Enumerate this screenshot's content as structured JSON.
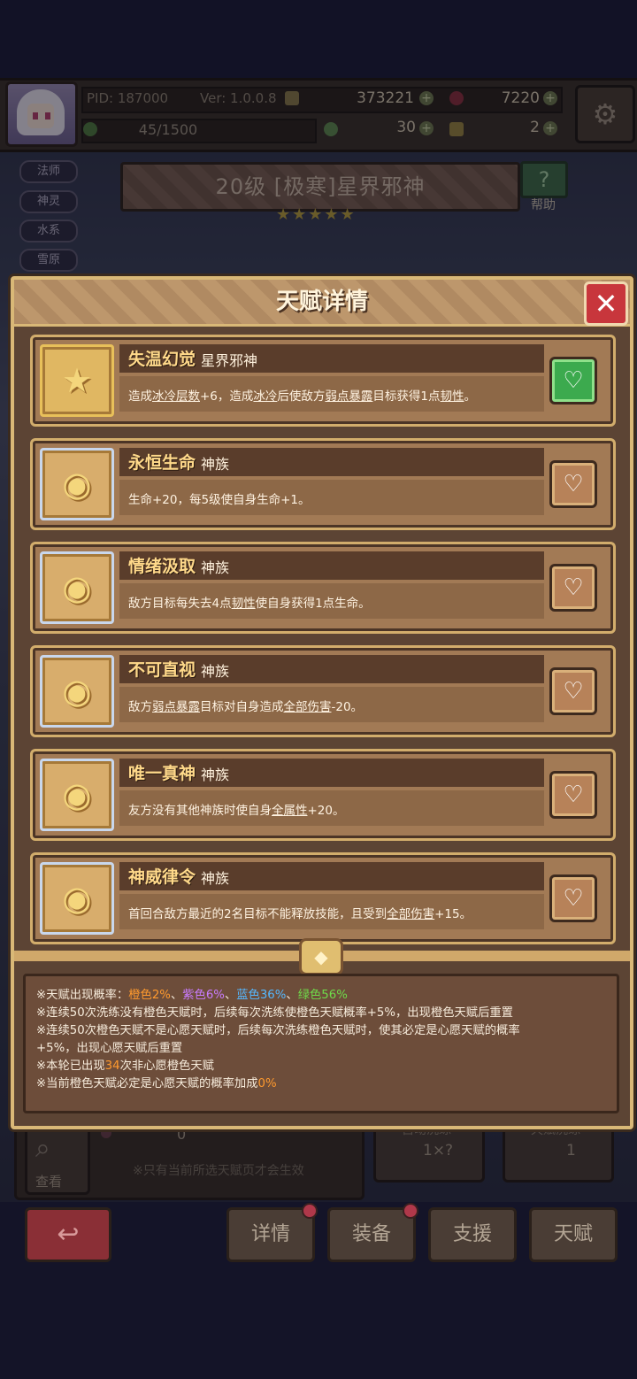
{
  "status_bar": {
    "pid": "PID: 187000",
    "version": "Ver: 1.0.0.8",
    "coins": "373221",
    "gems": "7220",
    "exp": "45/1500",
    "clover": "30",
    "keys": "2"
  },
  "side_tags": [
    "法师",
    "神灵",
    "水系",
    "雪原"
  ],
  "hero": {
    "title": "20级  [极寒]星界邪神",
    "stars": "★★★★★",
    "help_label": "帮助"
  },
  "background": {
    "count_value": "0",
    "note": "※只有当前所选天赋页才会生效",
    "view_label": "查看",
    "auto_wash_label": "自动洗练",
    "auto_wash_value": "1×?",
    "wash_label": "天赋洗练",
    "wash_value": "1",
    "nav": [
      "详情",
      "装备",
      "支援",
      "天赋"
    ]
  },
  "modal": {
    "title": "天赋详情",
    "close": "✕",
    "talents": [
      {
        "name": "失温幻觉",
        "tribe": "星界邪神",
        "desc_parts": [
          "造成",
          "冰冷层数",
          "+6，造成",
          "冰冷",
          "后使敌方",
          "弱点暴露",
          "目标获得1点",
          "韧性",
          "。"
        ],
        "favorited": true
      },
      {
        "name": "永恒生命",
        "tribe": "神族",
        "desc_parts": [
          "生命+20，每5级使自身生命+1。"
        ],
        "favorited": false
      },
      {
        "name": "情绪汲取",
        "tribe": "神族",
        "desc_parts": [
          "敌方目标每失去4点",
          "韧性",
          "使自身获得1点生命。"
        ],
        "favorited": false
      },
      {
        "name": "不可直视",
        "tribe": "神族",
        "desc_parts": [
          "敌方",
          "弱点暴露",
          "目标对自身造成",
          "全部伤害",
          "-20。"
        ],
        "favorited": false
      },
      {
        "name": "唯一真神",
        "tribe": "神族",
        "desc_parts": [
          "友方没有其他神族时使自身",
          "全属性",
          "+20。"
        ],
        "favorited": false
      },
      {
        "name": "神威律令",
        "tribe": "神族",
        "desc_parts": [
          "首回合敌方最近的2名目标不能释放技能，且受到",
          "全部伤害",
          "+15。"
        ],
        "favorited": false
      }
    ],
    "info": {
      "rate_prefix": "※天赋出现概率：",
      "orange": "橙色2%",
      "sep": "、",
      "purple": "紫色6%",
      "blue": "蓝色36%",
      "green": "绿色56%",
      "line2": "※连续50次洗练没有橙色天赋时，后续每次洗练使橙色天赋概率+5%，出现橙色天赋后重置",
      "line3": "※连续50次橙色天赋不是心愿天赋时，后续每次洗练橙色天赋时，使其必定是心愿天赋的概率",
      "line4": "+5%，出现心愿天赋后重置",
      "line5_a": "※本轮已出现",
      "line5_num": "34",
      "line5_b": "次非心愿橙色天赋",
      "line6_a": "※当前橙色天赋必定是心愿天赋的概率加成",
      "line6_num": "0%"
    }
  },
  "colors": {
    "orange": "#ff9a2e",
    "purple": "#c97cff",
    "blue": "#55b8ff",
    "green": "#6fdc4a",
    "close": "#c8363c",
    "fav_on": "#3caa4e"
  }
}
